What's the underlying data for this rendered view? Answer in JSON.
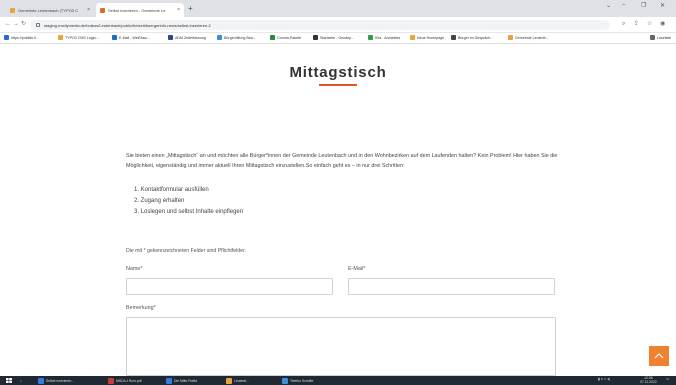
{
  "browser": {
    "tabs": [
      {
        "label": "Gemeinde Leutenbach (TYPO3 C",
        "favicon_color": "#e8a33c"
      },
      {
        "label": "Selbst inserieren - Gemeinde Le",
        "favicon_color": "#e06a2a"
      }
    ],
    "new_tab_glyph": "+",
    "url": "staging.rmcitymedia.de/hoteus/Leutenbach/public/freizeit/buergerinfo-news/selbst-inserieren-2",
    "bookmarks": [
      {
        "label": "https://publish.li...",
        "color": "#2a6ad8"
      },
      {
        "label": "TYPO3 CMS Login:...",
        "color": "#e8a33c"
      },
      {
        "label": "E-Mail - Weißhau...",
        "color": "#1b6dc1"
      },
      {
        "label": "ADM Zeiterfassung",
        "color": "#2c4a8a"
      },
      {
        "label": "Bürgerhilfung Bea...",
        "color": "#3b8ed8"
      },
      {
        "label": "Corona-Pakete",
        "color": "#2b8a3e"
      },
      {
        "label": "Startseite - Geodep...",
        "color": "#333333"
      },
      {
        "label": "Kita - Anmeldes",
        "color": "#2f9d4b"
      },
      {
        "label": "Neue Homepage",
        "color": "#e8a33c"
      },
      {
        "label": "Bürger im Gespräch...",
        "color": "#444444"
      },
      {
        "label": "Gemeinde Leutenb...",
        "color": "#e8a33c"
      }
    ],
    "reading_list": "Leseliste"
  },
  "page": {
    "title": "Mittagstisch",
    "accent_color": "#e0542a",
    "intro": "Sie bieten einen „Mittagstisch“ an und möchten alle Bürger*innen der Gemeinde Leutenbach und in den Wohnbezirken auf dem Laufenden halten? Kein Problem! Hier haben Sie die Möglichkeit, eigenständig und immer aktuell Ihren Mittagstisch einzustellen.So einfach geht es – in nur drei Schritten:",
    "steps": [
      "1. Kontaktformular ausfüllen",
      "2. Zugang erhalten",
      "3. Loslegen und selbst Inhalte einpflegen"
    ],
    "required_note": "Die mit * gekennzeichneten Felder sind Pflichtfelder.",
    "form": {
      "name_label": "Name*",
      "name_value": "",
      "email_label": "E-Mail*",
      "email_value": "",
      "comment_label": "Bemerkung*",
      "comment_value": ""
    },
    "scroll_top_color": "#ee8230"
  },
  "taskbar": {
    "items": [
      {
        "label": "Selbst inserieren...",
        "color": "#2f7fd8"
      },
      {
        "label": "MSDA-f Rum.pdf",
        "color": "#c83a3a"
      },
      {
        "label": "Die Mitte Rufild",
        "color": "#2f7fd8"
      },
      {
        "label": "Leutenb...",
        "color": "#e8a33c"
      },
      {
        "label": "Telefon Schritte",
        "color": "#3b8ed8"
      }
    ],
    "time": "12:06",
    "date": "07.11.2022"
  }
}
